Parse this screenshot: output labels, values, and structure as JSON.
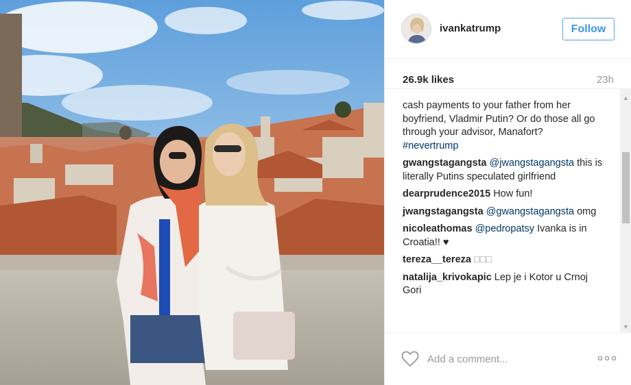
{
  "post": {
    "photo_alt": "photo",
    "username": "ivankatrump",
    "follow_label": "Follow",
    "likes": "26.9k likes",
    "time_ago": "23h"
  },
  "comments": [
    {
      "user": "",
      "text": "cash payments to your father from her boyfriend, Vladmir Putin? Or do those all go through your advisor, Manafort?",
      "tag": "#nevertrump"
    },
    {
      "user": "gwangstagangsta",
      "mention": "@jwangstagangsta",
      "text": "this is literally Putins speculated girlfriend"
    },
    {
      "user": "dearprudence2015",
      "text": "How fun!"
    },
    {
      "user": "jwangstagangsta",
      "mention": "@gwangstagangsta",
      "text": "omg"
    },
    {
      "user": "nicoleathomas",
      "mention": "@pedropatsy",
      "text": "Ivanka is in Croatia!! ♥"
    },
    {
      "user": "tereza__tereza",
      "text": "□□□"
    },
    {
      "user": "natalija_krivokapic",
      "text": "Lep je i Kotor u Crnoj Gori"
    }
  ],
  "add_comment": {
    "placeholder": "Add a comment..."
  },
  "icons": {
    "like": "heart-icon",
    "more": "more-options-icon",
    "scroll_up": "chevron-up-icon",
    "scroll_down": "chevron-down-icon"
  },
  "colors": {
    "follow_text": "#3897f0",
    "mention": "#003569",
    "muted": "#999999"
  }
}
